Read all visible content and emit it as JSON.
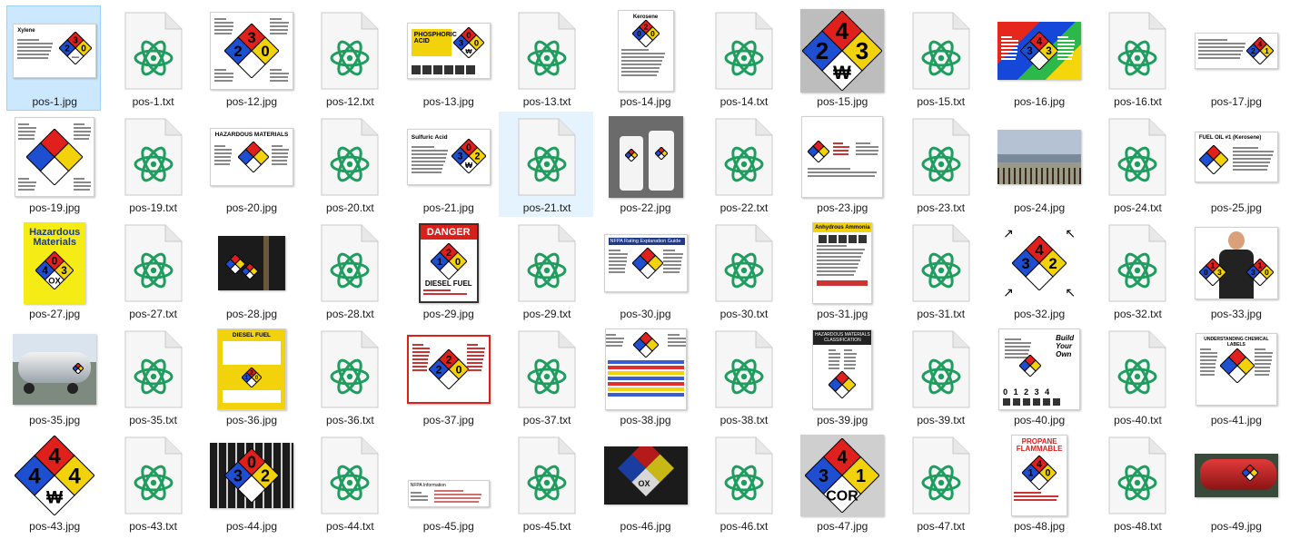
{
  "colors": {
    "selected_bg": "#cce8ff",
    "selected_border": "#99d1ff",
    "atom_green": "#1f9d5f",
    "nfpa_blue": "#1e4fd0",
    "nfpa_red": "#e0201c",
    "nfpa_yellow": "#f2d20a"
  },
  "files": [
    {
      "name": "pos-1.jpg",
      "kind": "image",
      "thumb": "sheet-diamond",
      "selected": true,
      "caption": "Xylene",
      "ratings": [
        "2",
        "3",
        "0"
      ]
    },
    {
      "name": "pos-1.txt",
      "kind": "text"
    },
    {
      "name": "pos-12.jpg",
      "kind": "image",
      "thumb": "big-diamond-sheet",
      "ratings": [
        "2",
        "3",
        "0"
      ]
    },
    {
      "name": "pos-12.txt",
      "kind": "text"
    },
    {
      "name": "pos-13.jpg",
      "kind": "image",
      "thumb": "label-yellow",
      "caption": "PHOSPHORIC ACID",
      "ratings": [
        "3",
        "0",
        "0"
      ]
    },
    {
      "name": "pos-13.txt",
      "kind": "text"
    },
    {
      "name": "pos-14.jpg",
      "kind": "image",
      "thumb": "portrait-diamond",
      "caption": "Kerosene",
      "ratings": [
        "0",
        "2",
        "0"
      ]
    },
    {
      "name": "pos-14.txt",
      "kind": "text"
    },
    {
      "name": "pos-15.jpg",
      "kind": "image",
      "thumb": "gray-diamond",
      "ratings": [
        "2",
        "4",
        "3"
      ],
      "special": "₩"
    },
    {
      "name": "pos-15.txt",
      "kind": "text"
    },
    {
      "name": "pos-16.jpg",
      "kind": "image",
      "thumb": "color-poster",
      "ratings": [
        "3",
        "4",
        "3"
      ]
    },
    {
      "name": "pos-16.txt",
      "kind": "text"
    },
    {
      "name": "pos-17.jpg",
      "kind": "image",
      "thumb": "small-table",
      "ratings": [
        "2",
        "4",
        "1"
      ]
    },
    {
      "name": "pos-19.jpg",
      "kind": "image",
      "thumb": "blank-diamond-sheet"
    },
    {
      "name": "pos-19.txt",
      "kind": "text"
    },
    {
      "name": "pos-20.jpg",
      "kind": "image",
      "thumb": "hazmat-sheet",
      "caption": "HAZARDOUS MATERIALS"
    },
    {
      "name": "pos-20.txt",
      "kind": "text"
    },
    {
      "name": "pos-21.jpg",
      "kind": "image",
      "thumb": "sulfuric",
      "caption": "Sulfuric Acid",
      "ratings": [
        "3",
        "0",
        "2"
      ]
    },
    {
      "name": "pos-21.txt",
      "kind": "text",
      "hover": true
    },
    {
      "name": "pos-22.jpg",
      "kind": "image",
      "thumb": "bottles-photo"
    },
    {
      "name": "pos-22.txt",
      "kind": "text"
    },
    {
      "name": "pos-23.jpg",
      "kind": "image",
      "thumb": "wide-sheet"
    },
    {
      "name": "pos-23.txt",
      "kind": "text"
    },
    {
      "name": "pos-24.jpg",
      "kind": "image",
      "thumb": "building-photo"
    },
    {
      "name": "pos-24.txt",
      "kind": "text"
    },
    {
      "name": "pos-25.jpg",
      "kind": "image",
      "thumb": "fuel-oil",
      "caption": "FUEL OIL #1 (Kerosene)"
    },
    {
      "name": "pos-27.jpg",
      "kind": "image",
      "thumb": "book-yellow",
      "caption": "Hazardous Materials",
      "ratings": [
        "4",
        "0",
        "3"
      ]
    },
    {
      "name": "pos-27.txt",
      "kind": "text"
    },
    {
      "name": "pos-28.jpg",
      "kind": "image",
      "thumb": "dark-door"
    },
    {
      "name": "pos-28.txt",
      "kind": "text"
    },
    {
      "name": "pos-29.jpg",
      "kind": "image",
      "thumb": "danger-sign",
      "caption": "DANGER",
      "footer": "DIESEL FUEL",
      "ratings": [
        "1",
        "2",
        "0"
      ]
    },
    {
      "name": "pos-29.txt",
      "kind": "text"
    },
    {
      "name": "pos-30.jpg",
      "kind": "image",
      "thumb": "guide-sheet",
      "caption": "NFPA Rating Explanation Guide"
    },
    {
      "name": "pos-30.txt",
      "kind": "text"
    },
    {
      "name": "pos-31.jpg",
      "kind": "image",
      "thumb": "ammonia",
      "caption": "Anhydrous Ammonia"
    },
    {
      "name": "pos-31.txt",
      "kind": "text"
    },
    {
      "name": "pos-32.jpg",
      "kind": "image",
      "thumb": "arrows-diamond",
      "ratings": [
        "3",
        "4",
        "2"
      ]
    },
    {
      "name": "pos-32.txt",
      "kind": "text"
    },
    {
      "name": "pos-33.jpg",
      "kind": "image",
      "thumb": "man-photo"
    },
    {
      "name": "pos-35.jpg",
      "kind": "image",
      "thumb": "tanker-photo"
    },
    {
      "name": "pos-35.txt",
      "kind": "text"
    },
    {
      "name": "pos-36.jpg",
      "kind": "image",
      "thumb": "diesel-yellow",
      "caption": "DIESEL FUEL"
    },
    {
      "name": "pos-36.txt",
      "kind": "text"
    },
    {
      "name": "pos-37.jpg",
      "kind": "image",
      "thumb": "kerosene-red",
      "ratings": [
        "2",
        "2",
        "0"
      ]
    },
    {
      "name": "pos-37.txt",
      "kind": "text"
    },
    {
      "name": "pos-38.jpg",
      "kind": "image",
      "thumb": "table-sheet"
    },
    {
      "name": "pos-38.txt",
      "kind": "text"
    },
    {
      "name": "pos-39.jpg",
      "kind": "image",
      "thumb": "hazmat-class",
      "caption": "HAZARDOUS MATERIALS CLASSIFICATION"
    },
    {
      "name": "pos-39.txt",
      "kind": "text"
    },
    {
      "name": "pos-40.jpg",
      "kind": "image",
      "thumb": "build-sign",
      "scale": "0 1 2 3 4"
    },
    {
      "name": "pos-40.txt",
      "kind": "text"
    },
    {
      "name": "pos-41.jpg",
      "kind": "image",
      "thumb": "understanding",
      "caption": "UNDERSTANDING CHEMICAL LABELS"
    },
    {
      "name": "pos-43.jpg",
      "kind": "image",
      "thumb": "plain-diamond",
      "ratings": [
        "4",
        "4",
        "4"
      ],
      "special": "₩"
    },
    {
      "name": "pos-43.txt",
      "kind": "text"
    },
    {
      "name": "pos-44.jpg",
      "kind": "image",
      "thumb": "fence-diamond",
      "ratings": [
        "3",
        "0",
        "2"
      ]
    },
    {
      "name": "pos-44.txt",
      "kind": "text"
    },
    {
      "name": "pos-45.jpg",
      "kind": "image",
      "thumb": "tiny-label",
      "caption": "NFPA Information"
    },
    {
      "name": "pos-45.txt",
      "kind": "text"
    },
    {
      "name": "pos-46.jpg",
      "kind": "image",
      "thumb": "dark-photo",
      "special": "OX"
    },
    {
      "name": "pos-46.txt",
      "kind": "text"
    },
    {
      "name": "pos-47.jpg",
      "kind": "image",
      "thumb": "cor-diamond",
      "ratings": [
        "3",
        "4",
        "1"
      ],
      "special": "COR"
    },
    {
      "name": "pos-47.txt",
      "kind": "text"
    },
    {
      "name": "pos-48.jpg",
      "kind": "image",
      "thumb": "propane",
      "caption": "PROPANE FLAMMABLE",
      "ratings": [
        "1",
        "4",
        "0"
      ]
    },
    {
      "name": "pos-48.txt",
      "kind": "text"
    },
    {
      "name": "pos-49.jpg",
      "kind": "image",
      "thumb": "red-tank"
    }
  ]
}
